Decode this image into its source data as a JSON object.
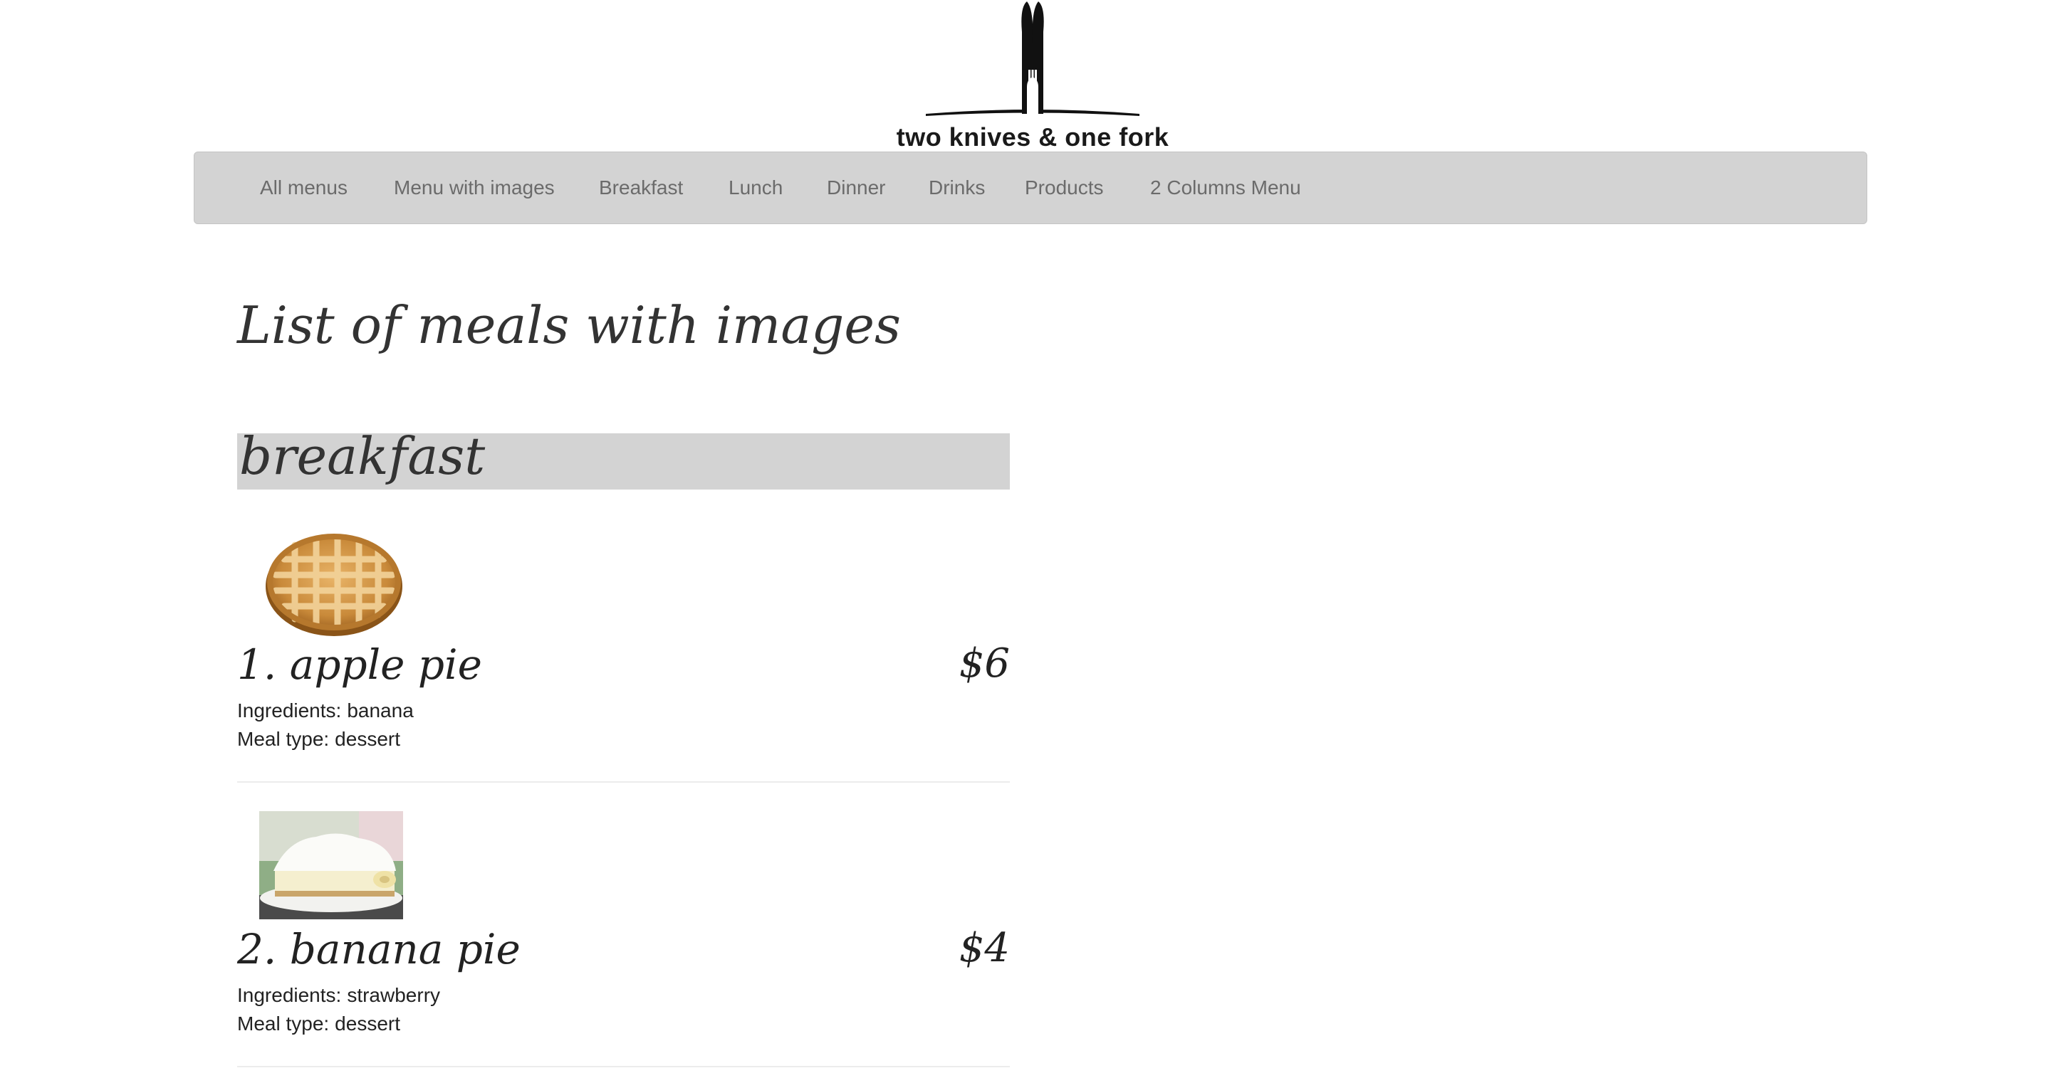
{
  "brand": {
    "logo_text": "two knives & one fork"
  },
  "nav": {
    "items": [
      {
        "label": "All menus"
      },
      {
        "label": "Menu with images"
      },
      {
        "label": "Breakfast"
      },
      {
        "label": "Lunch"
      },
      {
        "label": "Dinner"
      },
      {
        "label": "Drinks"
      },
      {
        "label": "Products"
      },
      {
        "label": "2 Columns Menu"
      }
    ]
  },
  "main": {
    "title": "List of meals with images",
    "section": {
      "title": "breakfast",
      "meals": [
        {
          "name": "1. apple pie",
          "price": "$6",
          "ingredients_label": "Ingredients:",
          "ingredients": "banana",
          "type_label": "Meal type:",
          "type": "dessert"
        },
        {
          "name": "2. banana pie",
          "price": "$4",
          "ingredients_label": "Ingredients:",
          "ingredients": "strawberry",
          "type_label": "Meal type:",
          "type": "dessert"
        }
      ]
    }
  },
  "colors": {
    "navbar_bg": "#d3d3d3",
    "nav_text": "#6b6b6b",
    "section_bg": "#d3d3d3",
    "text": "#222222"
  }
}
